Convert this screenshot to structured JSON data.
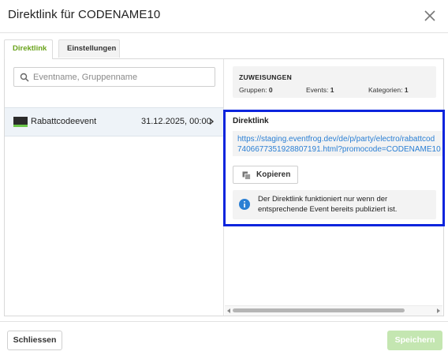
{
  "dialog": {
    "title": "Direktlink für CODENAME10"
  },
  "tabs": [
    {
      "label": "Direktlink",
      "active": true
    },
    {
      "label": "Einstellungen",
      "active": false
    }
  ],
  "search": {
    "placeholder": "Eventname, Gruppenname",
    "value": ""
  },
  "events": [
    {
      "name": "Rabattcodeevent",
      "date": "31.12.2025, 00:00",
      "selected": true
    }
  ],
  "zuweisungen": {
    "title": "ZUWEISUNGEN",
    "gruppen_label": "Gruppen:",
    "gruppen_value": "0",
    "events_label": "Events:",
    "events_value": "1",
    "kategorien_label": "Kategorien:",
    "kategorien_value": "1"
  },
  "direktlink": {
    "title": "Direktlink",
    "link_line1": "https://staging.eventfrog.dev/de/p/party/electro/rabattcod",
    "link_line2": "7406677351928807191.html?promocode=CODENAME10",
    "copy_label": "Kopieren",
    "info_text": "Der Direktlink funktioniert nur wenn der entsprechende Event bereits publiziert ist."
  },
  "footer": {
    "close_label": "Schliessen",
    "save_label": "Speichern"
  },
  "colors": {
    "accent_green": "#6aa31c",
    "link_blue": "#2a7fd4",
    "highlight": "#0b24dd",
    "save_disabled": "#c4e6b1"
  }
}
